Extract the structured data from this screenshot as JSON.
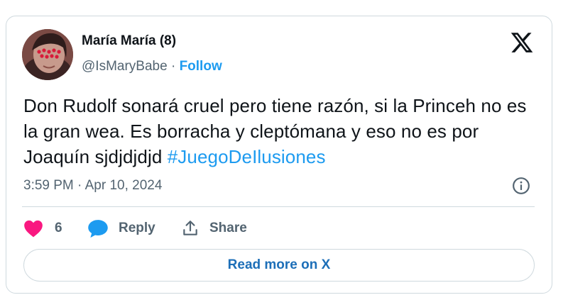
{
  "author": {
    "display_name": "María María (8)",
    "handle": "@IsMaryBabe",
    "separator": "·",
    "follow_label": "Follow",
    "avatar_icon": "profile-photo"
  },
  "tweet": {
    "text_main": "Don Rudolf sonará cruel pero tiene razón, si la Princeh no es la gran wea. Es borracha y cleptómana y eso no es por Joaquín sjdjdjdjd",
    "hashtag": "#JuegoDeIlusiones",
    "timestamp": "3:59 PM · Apr 10, 2024"
  },
  "actions": {
    "like_count": "6",
    "reply_label": "Reply",
    "share_label": "Share"
  },
  "read_more_label": "Read more on X",
  "colors": {
    "accent": "#1d9bf0",
    "like": "#f91880",
    "muted": "#536471",
    "border": "#cfd9de"
  }
}
